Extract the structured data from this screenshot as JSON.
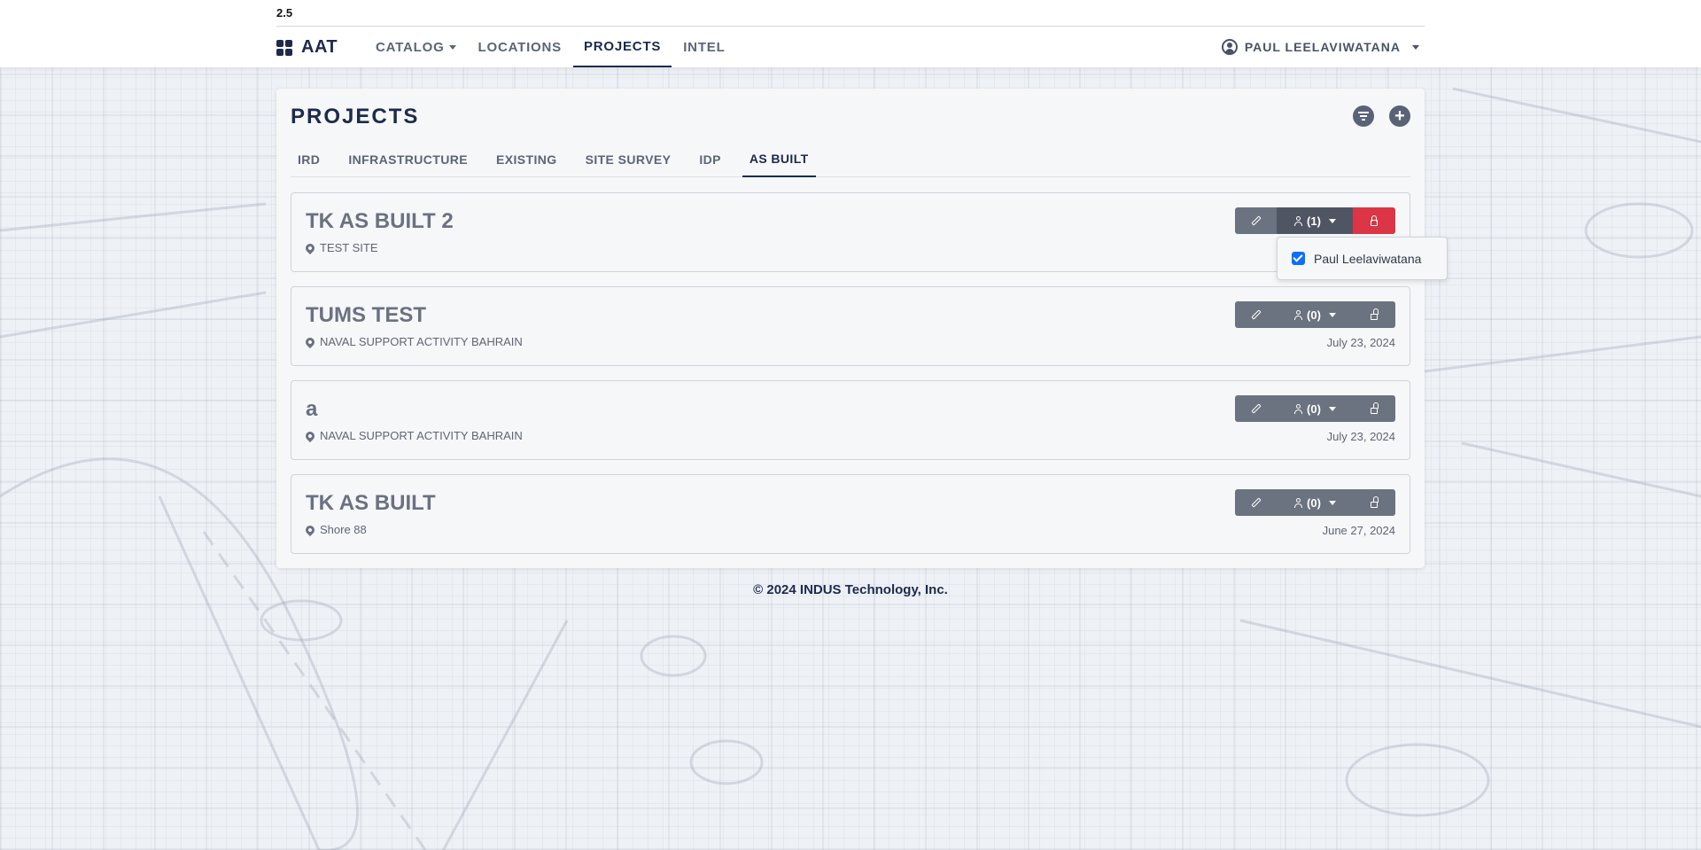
{
  "version": "2.5",
  "brand": {
    "name": "AAT",
    "icon": "grid-icon"
  },
  "nav": {
    "items": [
      {
        "label": "CATALOG",
        "has_dropdown": true,
        "active": false
      },
      {
        "label": "LOCATIONS",
        "active": false
      },
      {
        "label": "PROJECTS",
        "active": true
      },
      {
        "label": "INTEL",
        "active": false
      }
    ]
  },
  "user": {
    "name": "PAUL LEELAVIWATANA",
    "icon": "user-circle-icon"
  },
  "page": {
    "title": "PROJECTS",
    "actions": {
      "filter_icon": "filter-icon",
      "add_icon": "plus-icon",
      "add_symbol": "+"
    }
  },
  "tabs": [
    {
      "label": "IRD",
      "active": false
    },
    {
      "label": "INFRASTRUCTURE",
      "active": false
    },
    {
      "label": "EXISTING",
      "active": false
    },
    {
      "label": "SITE SURVEY",
      "active": false
    },
    {
      "label": "IDP",
      "active": false
    },
    {
      "label": "AS BUILT",
      "active": true
    }
  ],
  "projects": [
    {
      "title": "TK AS BUILT 2",
      "location": "TEST SITE",
      "date": "",
      "users_count": "(1)",
      "locked": true
    },
    {
      "title": "TUMS TEST",
      "location": "NAVAL SUPPORT ACTIVITY BAHRAIN",
      "date": "July 23, 2024",
      "users_count": "(0)",
      "locked": false
    },
    {
      "title": "a",
      "location": "NAVAL SUPPORT ACTIVITY BAHRAIN",
      "date": "July 23, 2024",
      "users_count": "(0)",
      "locked": false
    },
    {
      "title": "TK AS BUILT",
      "location": "Shore 88",
      "date": "June 27, 2024",
      "users_count": "(0)",
      "locked": false
    }
  ],
  "users_dropdown": {
    "items": [
      {
        "name": "Paul Leelaviwatana",
        "checked": true
      }
    ]
  },
  "footer": {
    "text": "© 2024 INDUS Technology, Inc."
  },
  "colors": {
    "primary": "#1d2a4d",
    "button_gray": "#6b7280",
    "danger": "#dc3545",
    "checkbox": "#0d6efd"
  }
}
